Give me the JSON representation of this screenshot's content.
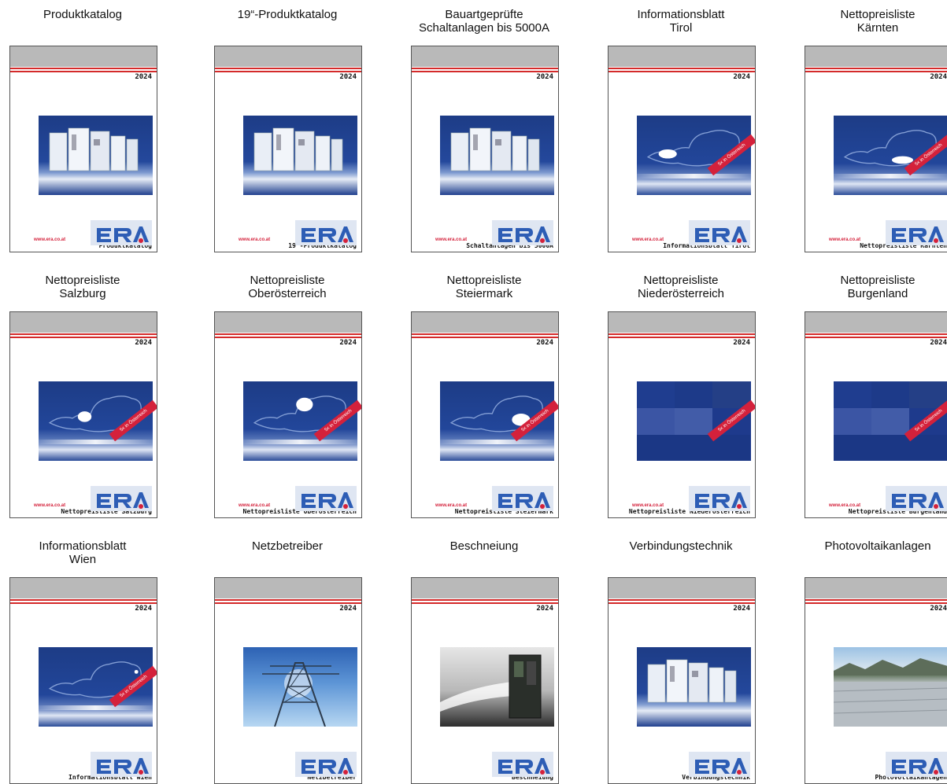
{
  "catalog": {
    "year_label": "2024",
    "url": "www.era.co.at",
    "sticker_text": "5x in Österreich",
    "logo_text": "ERA",
    "items": [
      {
        "title": "Produktkatalog",
        "cover_title": "Produktkatalog",
        "image": "cabinets-photo"
      },
      {
        "title": "19“-Produktkatalog",
        "cover_title": "19“-Produktkatalog",
        "image": "cabinets-photo"
      },
      {
        "title": "Bauartgeprüfte\nSchaltanlagen bis 5000A",
        "cover_title": "Bauartgeprüfte\nSchaltanlagen bis 5000A",
        "image": "cabinets-photo"
      },
      {
        "title": "Informationsblatt\nTirol",
        "cover_title": "Informationsblatt Tirol",
        "image": "austria-map"
      },
      {
        "title": "Nettopreisliste\nKärnten",
        "cover_title": "Nettopreisliste Kärnten",
        "image": "austria-map"
      },
      {
        "title": "Nettopreisliste\nSalzburg",
        "cover_title": "Nettopreisliste Salzburg",
        "image": "austria-map"
      },
      {
        "title": "Nettopreisliste\nOberösterreich",
        "cover_title": "Nettopreisliste Oberösterreich",
        "image": "austria-map"
      },
      {
        "title": "Nettopreisliste\nSteiermark",
        "cover_title": "Nettopreisliste Steiermark",
        "image": "austria-map"
      },
      {
        "title": "Nettopreisliste\nNiederösterreich",
        "cover_title": "Nettopreisliste Niederösterreich",
        "image": "tile-grid"
      },
      {
        "title": "Nettopreisliste\nBurgenland",
        "cover_title": "Nettopreisliste Burgenland",
        "image": "tile-grid"
      },
      {
        "title": "Informationsblatt\nWien",
        "cover_title": "Informationsblatt Wien",
        "image": "austria-map"
      },
      {
        "title": "Netzbetreiber",
        "cover_title": "Netzbetreiber",
        "image": "power-pylon-photo"
      },
      {
        "title": "Beschneiung",
        "cover_title": "Beschneiung",
        "image": "snow-cannon-photo"
      },
      {
        "title": "Verbindungstechnik",
        "cover_title": "Verbindungstechnik",
        "image": "cabinets-photo"
      },
      {
        "title": "Photovoltaikanlagen",
        "cover_title": "Photovoltaikanlagen",
        "image": "solar-panels-photo"
      }
    ]
  }
}
